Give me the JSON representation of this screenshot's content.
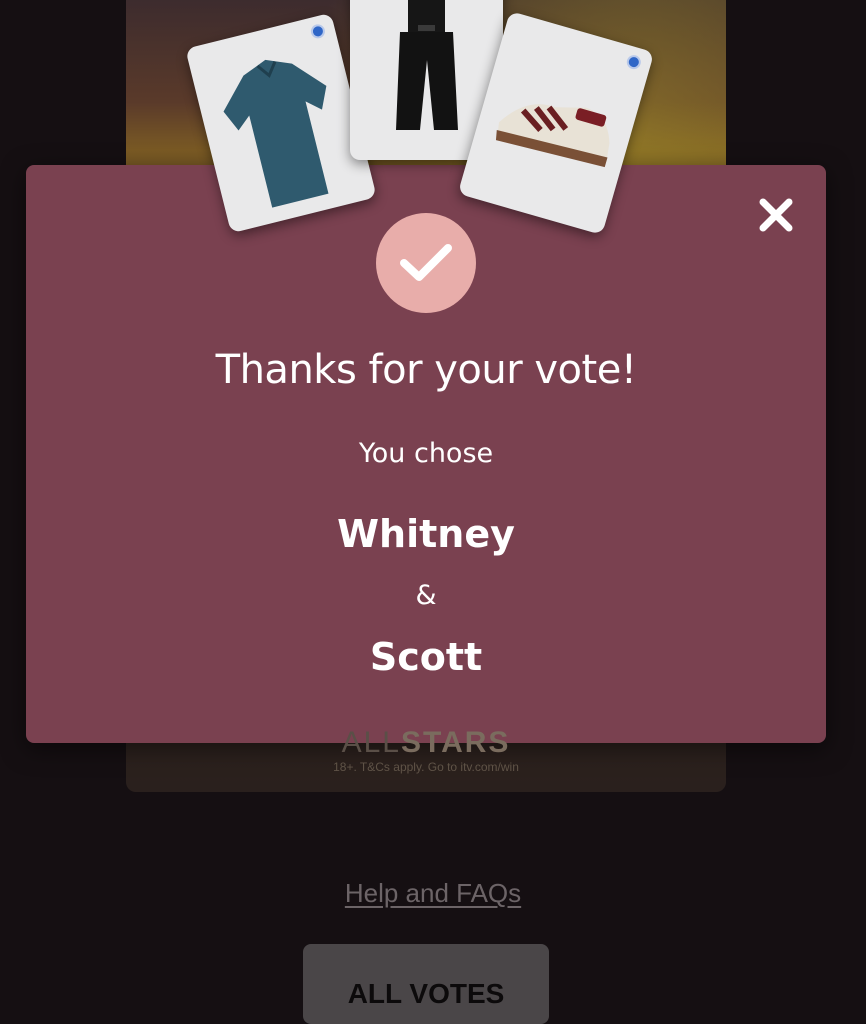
{
  "background": {
    "promo_word_light": "ALL",
    "promo_word_bold": "STARS",
    "terms": "18+. T&Cs apply. Go to itv.com/win",
    "items": [
      {
        "icon": "shirt-icon"
      },
      {
        "icon": "dungarees-icon"
      },
      {
        "icon": "sneaker-icon"
      }
    ]
  },
  "modal": {
    "icon": "check-icon",
    "close_icon": "close-icon",
    "title": "Thanks for your vote!",
    "subtitle": "You chose",
    "choice_1": "Whitney",
    "separator": "&",
    "choice_2": "Scott",
    "colors": {
      "background": "#7a4150",
      "check_circle": "#e8adaa",
      "text": "#ffffff"
    }
  },
  "footer": {
    "help_link": "Help and FAQs",
    "all_votes_button": "ALL VOTES"
  }
}
